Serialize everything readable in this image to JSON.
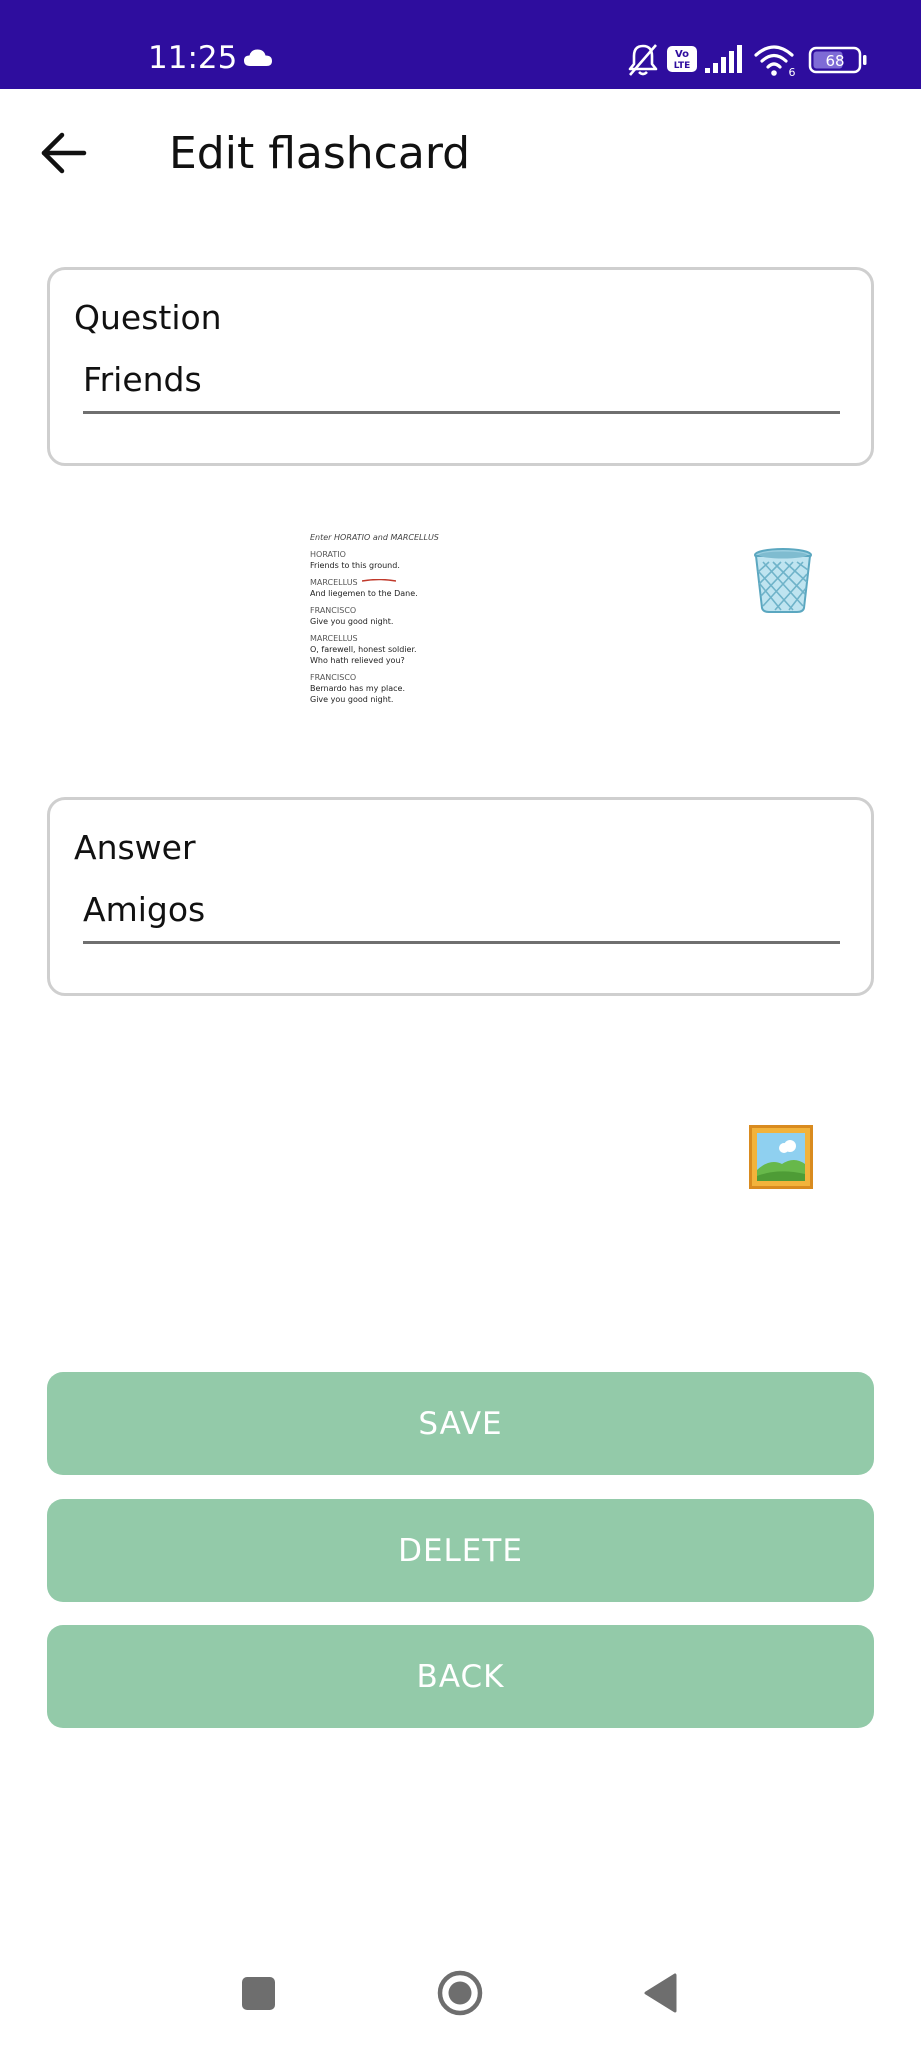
{
  "status_bar": {
    "time": "11:25",
    "battery_level": "68",
    "wifi_badge": "6",
    "volte_label_top": "Vo",
    "volte_label_bottom": "LTE",
    "icons": [
      "cloud-icon",
      "bell-off-icon",
      "volte-icon",
      "signal-icon",
      "wifi-icon",
      "battery-icon"
    ],
    "background_color": "#2e0d9e"
  },
  "app_bar": {
    "title": "Edit flashcard",
    "back_icon": "arrow-left-icon"
  },
  "question": {
    "label": "Question",
    "value": "Friends"
  },
  "question_image": {
    "lines": {
      "stage": "Enter HORATIO and MARCELLUS",
      "s1": "HORATIO",
      "l1": "Friends to this ground.",
      "s2": "MARCELLUS",
      "l2": "And liegemen to the Dane.",
      "s3": "FRANCISCO",
      "l3": "Give you good night.",
      "s4": "MARCELLUS",
      "l4a": "O, farewell, honest soldier.",
      "l4b": "Who hath relieved you?",
      "s5": "FRANCISCO",
      "l5a": "Bernardo has my place.",
      "l5b": "Give you good night."
    },
    "delete_icon": "wastebasket-icon"
  },
  "answer": {
    "label": "Answer",
    "value": "Amigos",
    "add_image_icon": "framed-picture-icon"
  },
  "actions": {
    "save_label": "SAVE",
    "delete_label": "DELETE",
    "back_label": "BACK",
    "button_color": "#93caa9"
  },
  "nav_bar": {
    "icons": [
      "recents-square-icon",
      "home-circle-icon",
      "back-triangle-icon"
    ]
  }
}
